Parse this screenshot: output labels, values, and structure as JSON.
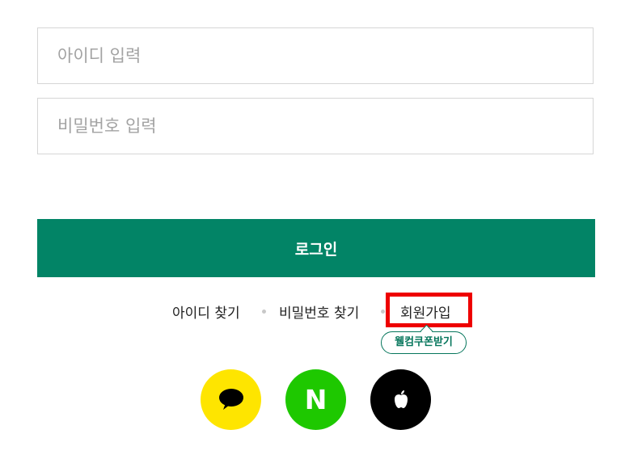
{
  "form": {
    "id_placeholder": "아이디 입력",
    "pw_placeholder": "비밀번호 입력",
    "login_label": "로그인"
  },
  "links": {
    "find_id": "아이디 찾기",
    "find_pw": "비밀번호 찾기",
    "signup": "회원가입",
    "coupon": "웰컴쿠폰받기"
  },
  "social": [
    {
      "name": "kakao",
      "icon": "speech-bubble-icon",
      "color": "#fee500"
    },
    {
      "name": "naver",
      "icon": "naver-n-icon",
      "label": "N",
      "color": "#1ec800"
    },
    {
      "name": "apple",
      "icon": "apple-icon",
      "color": "#000000"
    }
  ],
  "colors": {
    "primary": "#028466",
    "highlight": "#ee0000",
    "coupon": "#06765c"
  }
}
